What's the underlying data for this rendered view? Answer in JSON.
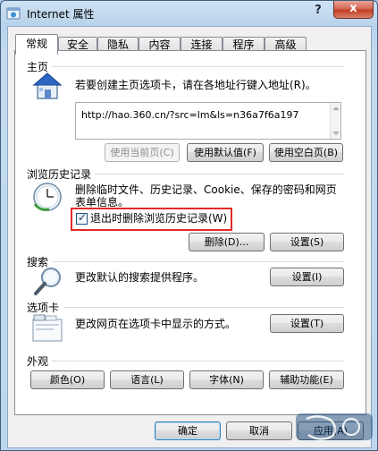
{
  "window": {
    "title": "Internet 属性",
    "help": "?",
    "close": "x"
  },
  "tabs": [
    "常规",
    "安全",
    "隐私",
    "内容",
    "连接",
    "程序",
    "高级"
  ],
  "home": {
    "label": "主页",
    "description": "若要创建主页选项卡，请在各地址行键入地址(R)。",
    "url": "http://hao.360.cn/?src=lm&ls=n36a7f6a197",
    "btn_current": "使用当前页(C)",
    "btn_default": "使用默认值(F)",
    "btn_blank": "使用空白页(B)"
  },
  "history": {
    "label": "浏览历史记录",
    "description_line1": "删除临时文件、历史记录、Cookie、保存的密码和网页",
    "description_line2": "表单信息。",
    "checkbox_label": "退出时删除浏览历史记录(W)",
    "btn_delete": "删除(D)...",
    "btn_settings": "设置(S)"
  },
  "search": {
    "label": "搜索",
    "description": "更改默认的搜索提供程序。",
    "btn_settings": "设置(I)"
  },
  "tabs_section": {
    "label": "选项卡",
    "description": "更改网页在选项卡中显示的方式。",
    "btn_settings": "设置(T)"
  },
  "appearance": {
    "label": "外观",
    "btn_colors": "颜色(O)",
    "btn_languages": "语言(L)",
    "btn_fonts": "字体(N)",
    "btn_accessibility": "辅助功能(E)"
  },
  "footer": {
    "ok": "确定",
    "cancel": "取消",
    "apply": "应用(A)"
  }
}
